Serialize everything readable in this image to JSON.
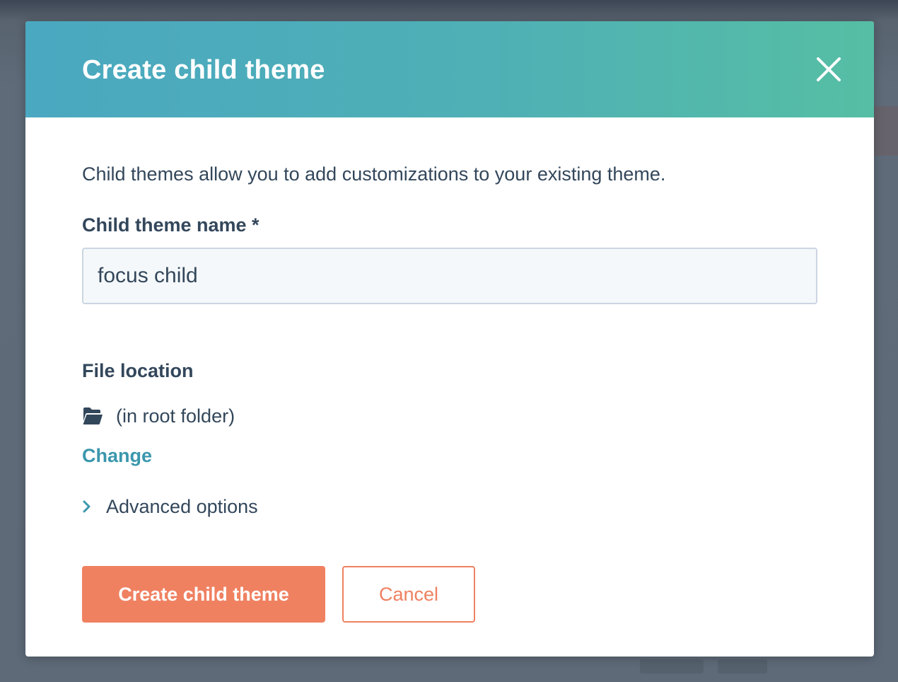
{
  "modal": {
    "title": "Create child theme",
    "close_icon": "close-icon",
    "header_gradient": [
      "#4aa8c0",
      "#56bea4"
    ]
  },
  "body": {
    "description": "Child themes allow you to add customizations to your existing theme.",
    "name_field": {
      "label": "Child theme name *",
      "value": "focus child"
    },
    "file_location": {
      "label": "File location",
      "icon": "folder-open-icon",
      "value": "(in root folder)",
      "change_label": "Change"
    },
    "advanced": {
      "icon": "chevron-right-icon",
      "label": "Advanced options"
    }
  },
  "footer": {
    "primary_label": "Create child theme",
    "cancel_label": "Cancel"
  },
  "colors": {
    "accent": "#ef8161",
    "link": "#3b97ad",
    "text": "#33475b"
  }
}
